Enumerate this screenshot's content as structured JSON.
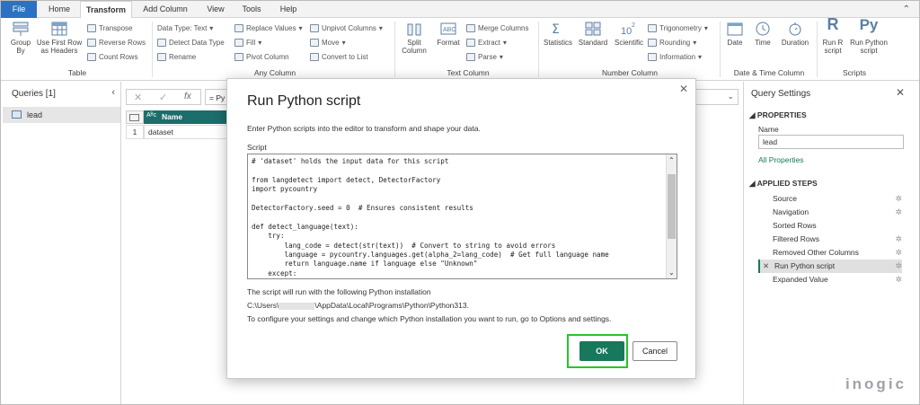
{
  "ribbon": {
    "tabs": [
      "File",
      "Home",
      "Transform",
      "Add Column",
      "View",
      "Tools",
      "Help"
    ],
    "table_group": {
      "label": "Table",
      "group_by": "Group By",
      "use_first_row": "Use First Row as Headers",
      "transpose": "Transpose",
      "reverse_rows": "Reverse Rows",
      "count_rows": "Count Rows"
    },
    "any_column_group": {
      "label": "Any Column",
      "data_type": "Data Type: Text",
      "detect_data_type": "Detect Data Type",
      "rename": "Rename",
      "replace_values": "Replace Values",
      "fill": "Fill",
      "pivot_column": "Pivot Column",
      "unpivot_columns": "Unpivot Columns",
      "move": "Move",
      "convert_to_list": "Convert to List"
    },
    "text_column_group": {
      "label": "Text Column",
      "split_column": "Split Column",
      "format": "Format",
      "merge_columns": "Merge Columns",
      "extract": "Extract",
      "parse": "Parse"
    },
    "number_column_group": {
      "label": "Number Column",
      "statistics": "Statistics",
      "standard": "Standard",
      "scientific": "Scientific",
      "trigonometry": "Trigonometry",
      "rounding": "Rounding",
      "information": "Information"
    },
    "datetime_group": {
      "label": "Date & Time Column",
      "date": "Date",
      "time": "Time",
      "duration": "Duration"
    },
    "scripts_group": {
      "label": "Scripts",
      "run_r": "Run R script",
      "run_python": "Run Python script"
    }
  },
  "queries": {
    "header": "Queries [1]",
    "items": [
      "lead"
    ]
  },
  "grid": {
    "formula_prefix": "= Py",
    "column_header": "Name",
    "rows": [
      {
        "index": "1",
        "value": "dataset"
      }
    ]
  },
  "settings": {
    "header": "Query Settings",
    "properties_header": "PROPERTIES",
    "name_label": "Name",
    "name_value": "lead",
    "all_properties": "All Properties",
    "steps_header": "APPLIED STEPS",
    "steps": [
      "Source",
      "Navigation",
      "Sorted Rows",
      "Filtered Rows",
      "Removed Other Columns",
      "Run Python script",
      "Expanded Value"
    ]
  },
  "dialog": {
    "title": "Run Python script",
    "description": "Enter Python scripts into the editor to transform and shape your data.",
    "script_label": "Script",
    "code_lines": [
      "# 'dataset' holds the input data for this script",
      "",
      "from langdetect import detect, DetectorFactory",
      "import pycountry",
      "",
      "DetectorFactory.seed = 0  # Ensures consistent results",
      "",
      "def detect_language(text):",
      "    try:",
      "        lang_code = detect(str(text))  # Convert to string to avoid errors",
      "        language = pycountry.languages.get(alpha_2=lang_code)  # Get full language name",
      "        return language.name if language else \"Unknown\"",
      "    except:"
    ],
    "install_note": "The script will run with the following Python installation",
    "path_prefix": "C:\\Users\\",
    "path_suffix": "\\AppData\\Local\\Programs\\Python\\Python313.",
    "config_note": "To configure your settings and change which Python installation you want to run, go to Options and settings.",
    "ok_label": "OK",
    "cancel_label": "Cancel"
  },
  "watermark": "inogic",
  "colors": {
    "file_tab": "#2b72c2",
    "ok_button": "#17785c",
    "highlight_ring": "#27c42b",
    "grid_header": "#1b6e6b"
  }
}
